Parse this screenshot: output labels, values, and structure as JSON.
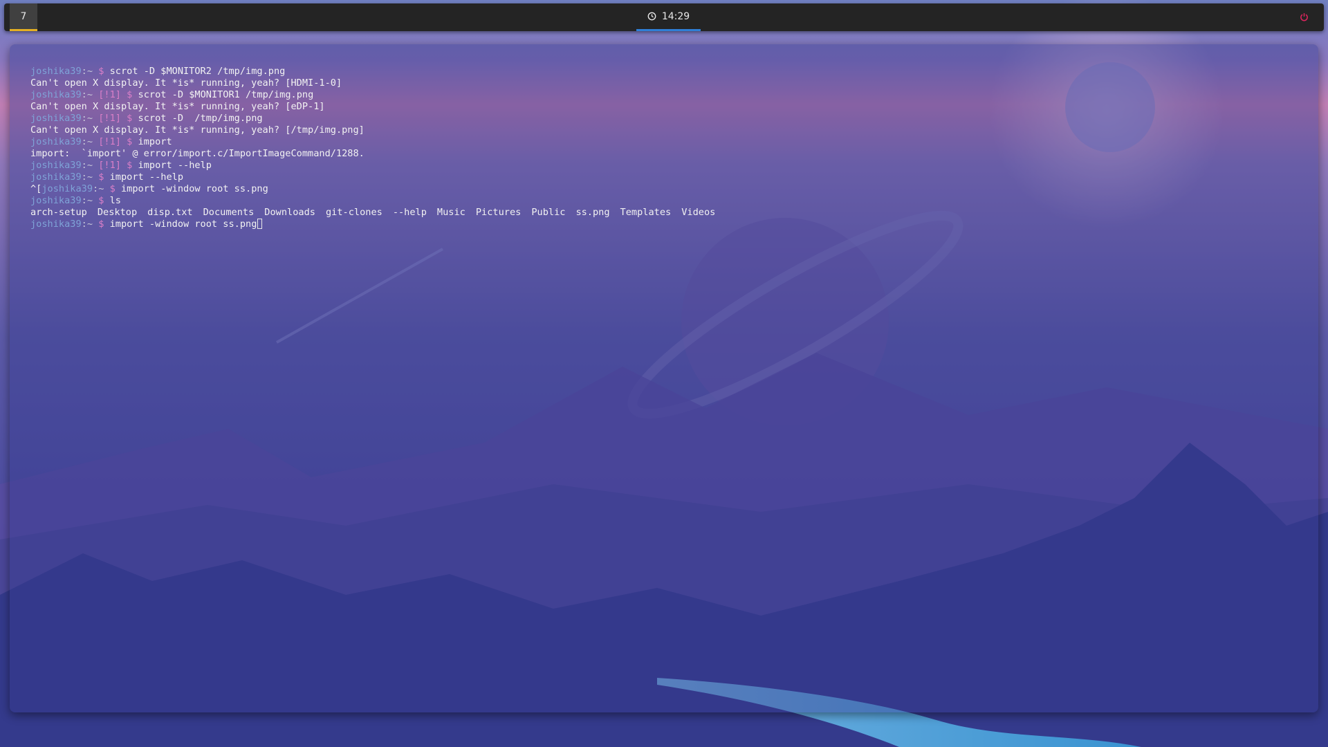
{
  "taskbar": {
    "workspace": "7",
    "clock": "14:29",
    "colors": {
      "bar": "#242424",
      "workspace_indicator": "#e4b023",
      "clock_indicator": "#2f7fd6",
      "power_icon": "#e0245e"
    }
  },
  "terminal": {
    "user": "joshika39",
    "lines": {
      "l1_cmd": "scrot -D $MONITOR2 /tmp/img.png",
      "l2_out": "Can't open X display. It *is* running, yeah? [HDMI-1-0]",
      "l3_cmd": "scrot -D $MONITOR1 /tmp/img.png",
      "l4_out": "Can't open X display. It *is* running, yeah? [eDP-1]",
      "l5_cmd": "scrot -D  /tmp/img.png",
      "l6_out": "Can't open X display. It *is* running, yeah? [/tmp/img.png]",
      "l7_cmd": "import",
      "l8_out": "import:  `import' @ error/import.c/ImportImageCommand/1288.",
      "l9_cmd": "import --help",
      "l10_cmd": "import --help",
      "l11_prefix": "^[",
      "l11_cmd": "import -window root ss.png",
      "l12_cmd": "ls",
      "l14_cmd": "import -window root ss.png"
    },
    "prompt_sep": ":~ ",
    "prompt_dollar": "$",
    "bang_marker": "[!1]",
    "ls_output": [
      "arch-setup",
      "Desktop",
      "disp.txt",
      "Documents",
      "Downloads",
      "git-clones",
      "--help",
      "Music",
      "Pictures",
      "Public",
      "ss.png",
      "Templates",
      "Videos"
    ],
    "colors": {
      "user": "#7fa3d7",
      "dollar": "#d97fc8",
      "text": "#f2f2f2"
    }
  }
}
